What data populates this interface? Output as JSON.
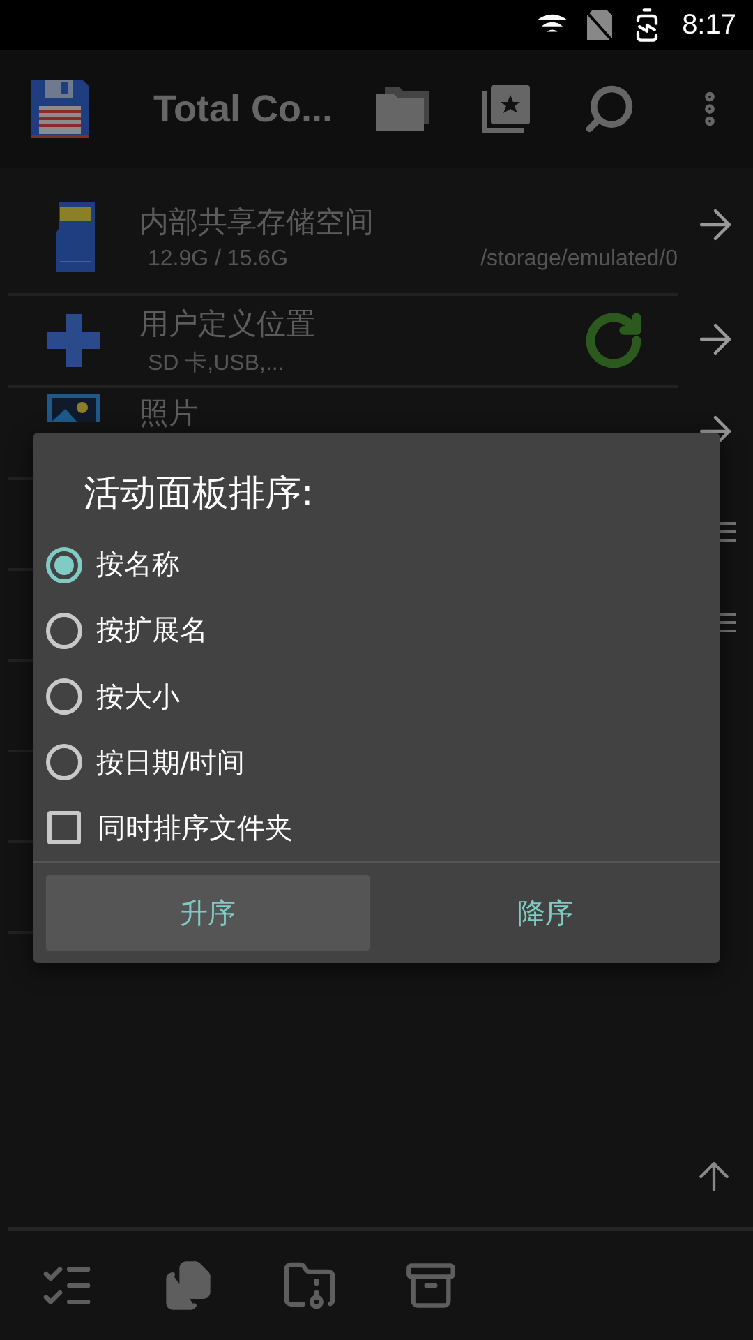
{
  "status_bar": {
    "time": "8:17"
  },
  "toolbar": {
    "title": "Total Co..."
  },
  "locations": [
    {
      "kind": "storage",
      "name": "内部共享存储空间",
      "detail": "12.9G / 15.6G",
      "path": "/storage/emulated/0"
    },
    {
      "kind": "custom",
      "name": "用户定义位置",
      "detail": "SD 卡,USB,..."
    },
    {
      "kind": "photos",
      "name": "照片"
    }
  ],
  "dialog": {
    "title": "活动面板排序:",
    "options": [
      {
        "label": "按名称",
        "selected": true
      },
      {
        "label": "按扩展名",
        "selected": false
      },
      {
        "label": "按大小",
        "selected": false
      },
      {
        "label": "按日期/时间",
        "selected": false
      }
    ],
    "checkbox": {
      "label": "同时排序文件夹",
      "checked": false
    },
    "buttons": [
      {
        "label": "升序",
        "focused": true
      },
      {
        "label": "降序",
        "focused": false
      }
    ]
  }
}
